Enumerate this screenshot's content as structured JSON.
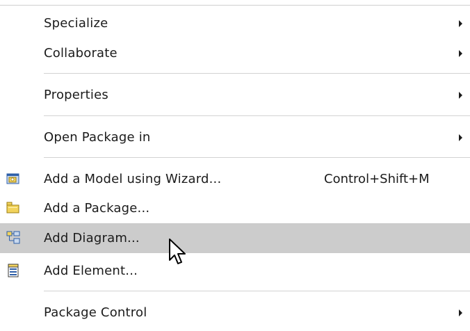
{
  "menu": {
    "items": [
      {
        "label": "Specialize",
        "has_submenu": true
      },
      {
        "label": "Collaborate",
        "has_submenu": true
      },
      {
        "label": "Properties",
        "has_submenu": true
      },
      {
        "label": "Open Package in",
        "has_submenu": true
      },
      {
        "label": "Add a Model using Wizard...",
        "shortcut": "Control+Shift+M",
        "icon": "model-wizard-icon"
      },
      {
        "label": "Add a Package...",
        "icon": "package-icon"
      },
      {
        "label": "Add Diagram...",
        "icon": "diagram-icon",
        "highlighted": true
      },
      {
        "label": "Add Element...",
        "icon": "element-icon"
      },
      {
        "label": "Package Control",
        "has_submenu": true
      }
    ]
  },
  "colors": {
    "highlight": "#cccccc",
    "separator": "#d2d2d2",
    "text": "#1b1b1b",
    "icon_yellow": "#f2d35c",
    "icon_blue": "#2e5fa8"
  }
}
